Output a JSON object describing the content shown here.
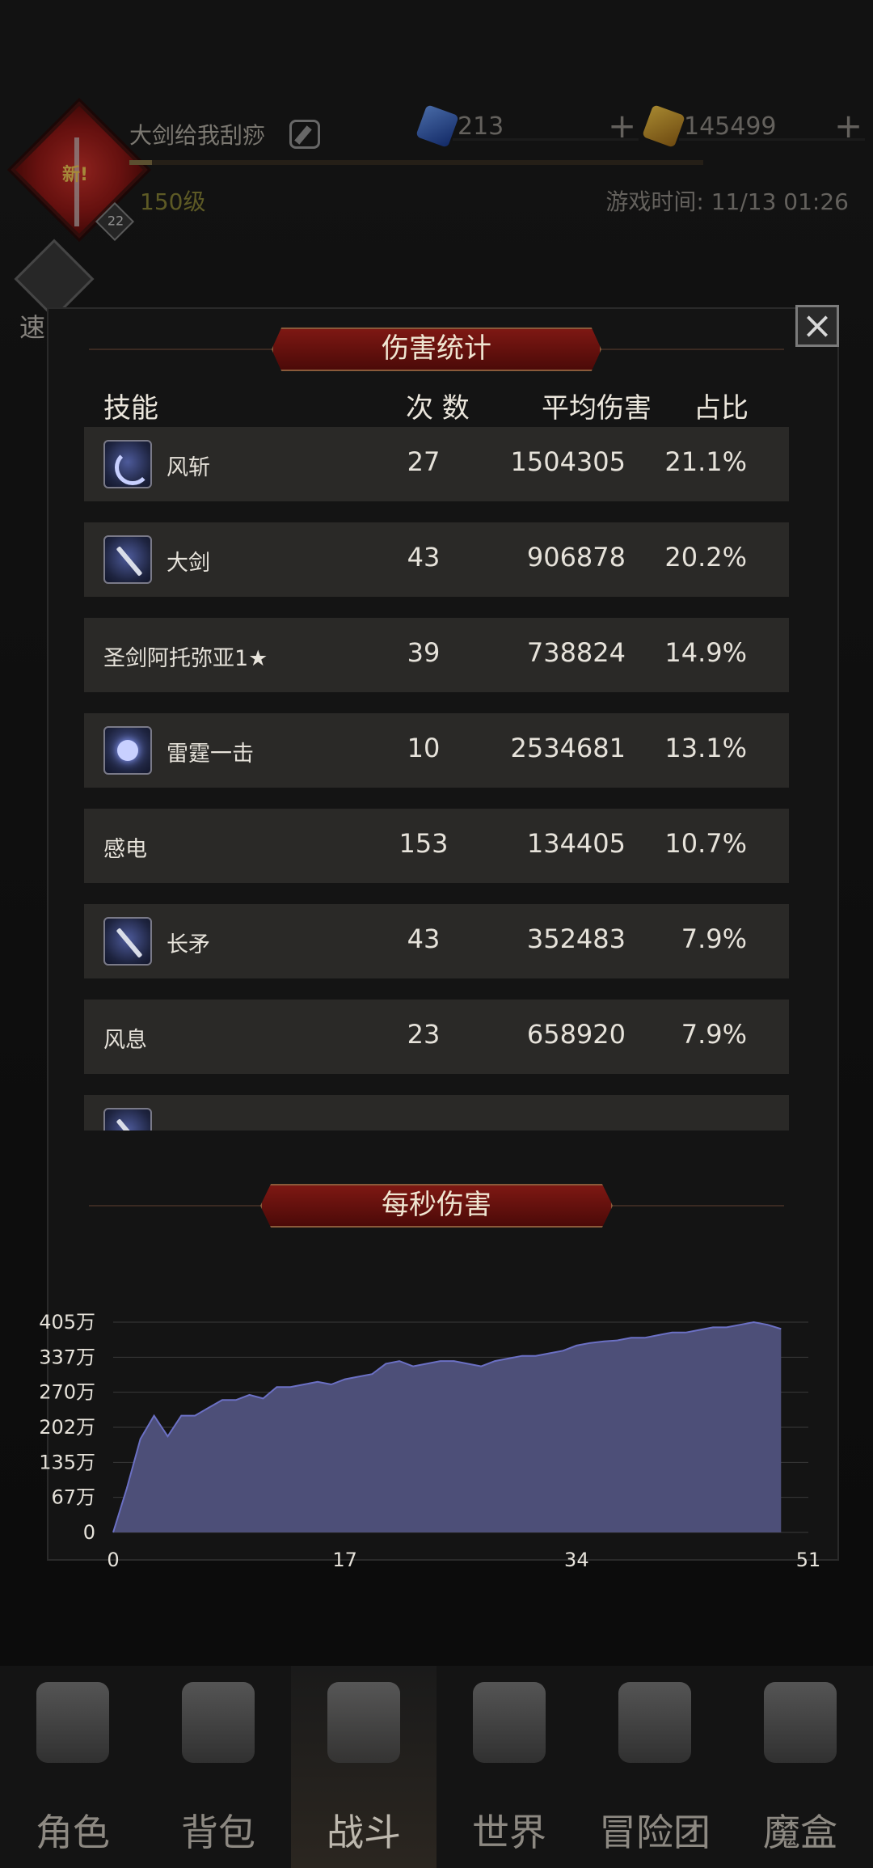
{
  "header": {
    "avatar_badge": "新!",
    "avatar_level_chip": "22",
    "player_name": "大剑给我刮痧",
    "level": "150级",
    "game_time": "游戏时间: 11/13 01:26",
    "xp_fraction": 0.04
  },
  "currencies": [
    {
      "value": "213",
      "icon": "blue-gem-icon"
    },
    {
      "value": "145499",
      "icon": "gold-coin-icon"
    }
  ],
  "quick_battle_label": "速战",
  "stats": {
    "title": "伤害统计",
    "columns": {
      "skill": "技能",
      "count": "次 数",
      "avg": "平均伤害",
      "ratio": "占比"
    },
    "rows": [
      {
        "icon": "wind-slash-icon",
        "name": "风斩",
        "count": "27",
        "avg": "1504305",
        "ratio": "21.1%"
      },
      {
        "icon": "greatsword-icon",
        "name": "大剑",
        "count": "43",
        "avg": "906878",
        "ratio": "20.2%"
      },
      {
        "icon": "",
        "name": "圣剑阿托弥亚1★",
        "count": "39",
        "avg": "738824",
        "ratio": "14.9%"
      },
      {
        "icon": "thunder-strike-icon",
        "name": "雷霆一击",
        "count": "10",
        "avg": "2534681",
        "ratio": "13.1%"
      },
      {
        "icon": "",
        "name": "感电",
        "count": "153",
        "avg": "134405",
        "ratio": "10.7%"
      },
      {
        "icon": "spear-icon",
        "name": "长矛",
        "count": "43",
        "avg": "352483",
        "ratio": "7.9%"
      },
      {
        "icon": "",
        "name": "风息",
        "count": "23",
        "avg": "658920",
        "ratio": "7.9%"
      },
      {
        "icon": "sword-icon",
        "name": "",
        "count": "",
        "avg": "",
        "ratio": ""
      }
    ]
  },
  "dps": {
    "title": "每秒伤害"
  },
  "chart_data": {
    "type": "area",
    "title": "每秒伤害",
    "xlabel": "",
    "ylabel": "",
    "x_ticks": [
      "0",
      "17",
      "34",
      "51"
    ],
    "y_ticks": [
      "0",
      "67万",
      "135万",
      "202万",
      "270万",
      "337万",
      "405万"
    ],
    "xlim": [
      0,
      51
    ],
    "ylim": [
      0,
      405
    ],
    "y_unit": "万",
    "grid": true,
    "color": "#4d4f78",
    "x": [
      0,
      1,
      2,
      3,
      4,
      5,
      6,
      7,
      8,
      9,
      10,
      11,
      12,
      13,
      14,
      15,
      16,
      17,
      18,
      19,
      20,
      21,
      22,
      23,
      24,
      25,
      26,
      27,
      28,
      29,
      30,
      31,
      32,
      33,
      34,
      35,
      36,
      37,
      38,
      39,
      40,
      41,
      42,
      43,
      44,
      45,
      46,
      47,
      48,
      49
    ],
    "values": [
      0,
      85,
      180,
      225,
      185,
      225,
      225,
      240,
      255,
      255,
      265,
      258,
      280,
      280,
      285,
      290,
      285,
      295,
      300,
      305,
      325,
      330,
      320,
      325,
      330,
      330,
      325,
      320,
      330,
      335,
      340,
      340,
      345,
      350,
      360,
      365,
      368,
      370,
      375,
      375,
      380,
      385,
      385,
      390,
      395,
      395,
      400,
      405,
      400,
      392
    ]
  },
  "nav": {
    "items": [
      {
        "label": "角色",
        "icon": "helmet-icon",
        "active": false
      },
      {
        "label": "背包",
        "icon": "backpack-icon",
        "active": false
      },
      {
        "label": "战斗",
        "icon": "sword-shield-icon",
        "active": true
      },
      {
        "label": "世界",
        "icon": "map-scroll-icon",
        "active": false
      },
      {
        "label": "冒险团",
        "icon": "castle-icon",
        "active": false
      },
      {
        "label": "魔盒",
        "icon": "cube-icon",
        "active": false
      }
    ]
  }
}
